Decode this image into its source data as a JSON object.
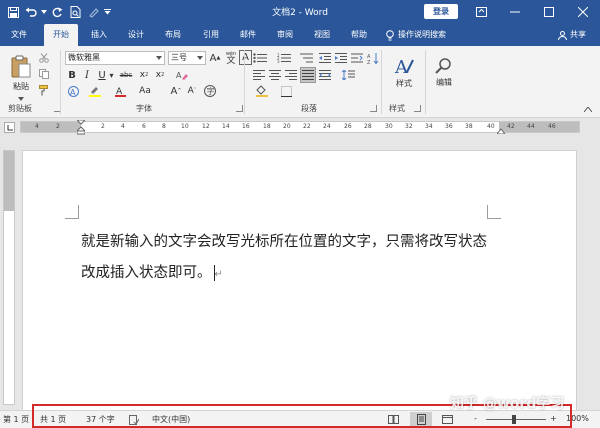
{
  "window": {
    "title": "文档2 - Word",
    "login_label": "登录"
  },
  "tabs": [
    {
      "label": "文件"
    },
    {
      "label": "开始"
    },
    {
      "label": "插入"
    },
    {
      "label": "设计"
    },
    {
      "label": "布局"
    },
    {
      "label": "引用"
    },
    {
      "label": "邮件"
    },
    {
      "label": "审阅"
    },
    {
      "label": "视图"
    },
    {
      "label": "帮助"
    },
    {
      "label": "操作说明搜索"
    }
  ],
  "share_label": "共享",
  "ribbon": {
    "clipboard": {
      "paste_label": "粘贴",
      "group_label": "剪贴板"
    },
    "font": {
      "font_name": "微软雅黑",
      "font_size": "三号",
      "wen_label": "wén",
      "group_label": "字体"
    },
    "paragraph": {
      "group_label": "段落"
    },
    "styles": {
      "button_label": "样式",
      "group_label": "样式"
    },
    "editing": {
      "button_label": "编辑"
    }
  },
  "ruler": {
    "ticks": [
      "4",
      "2",
      "2",
      "4",
      "6",
      "8",
      "10",
      "12",
      "14",
      "16",
      "18",
      "20",
      "22",
      "24",
      "26",
      "28",
      "30",
      "32",
      "34",
      "36",
      "38",
      "40",
      "42",
      "44",
      "46"
    ]
  },
  "document": {
    "text": "就是新输入的文字会改写光标所在位置的文字，只需将改写状态改成插入状态即可。",
    "paragraph_mark": "↵"
  },
  "status": {
    "page_indicator": "第 1 页",
    "total_pages": "共 1 页",
    "word_count": "37 个字",
    "language": "中文(中国)",
    "zoom_minus": "-",
    "zoom_plus": "+",
    "zoom_level": "100%"
  },
  "watermark": "知乎 @word字习",
  "colors": {
    "brand": "#2b579a",
    "highlight": "#d42a2a"
  }
}
